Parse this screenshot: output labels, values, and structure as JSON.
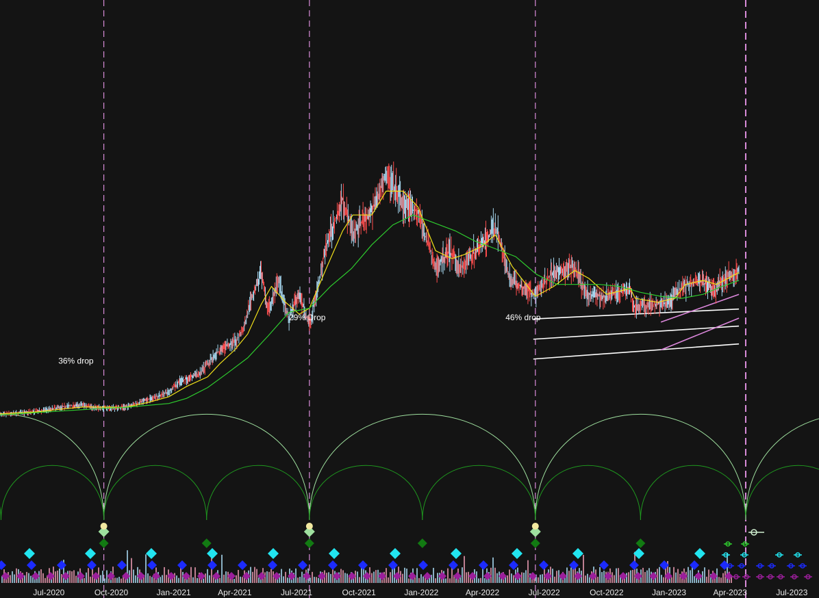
{
  "chart_data": {
    "type": "line",
    "title": "",
    "xlabel": "",
    "ylabel": "",
    "x_ticks": [
      "Jul-2020",
      "Oct-2020",
      "Jan-2021",
      "Apr-2021",
      "Jul-2021",
      "Oct-2021",
      "Jan-2022",
      "Apr-2022",
      "Jul-2022",
      "Oct-2022",
      "Jan-2023",
      "Apr-2023",
      "Jul-2023"
    ],
    "xlim": [
      "2020-04-20",
      "2023-08-10"
    ],
    "ylim": [
      0,
      100
    ],
    "y_axis_visible": false,
    "grid": false,
    "series": [
      {
        "color": "#ff6b6b",
        "x": [
          "2020-04-20",
          "2020-06-15",
          "2020-07-20",
          "2020-08-20",
          "2020-09-05",
          "2020-09-20",
          "2020-10-20",
          "2020-11-25",
          "2020-12-25",
          "2021-01-10",
          "2021-02-10",
          "2021-03-01",
          "2021-03-15",
          "2021-04-01",
          "2021-04-14",
          "2021-04-25",
          "2021-05-10",
          "2021-05-20",
          "2021-06-05",
          "2021-06-20",
          "2021-07-05",
          "2021-07-20",
          "2021-08-15",
          "2021-09-07",
          "2021-09-22",
          "2021-10-20",
          "2021-11-10",
          "2021-12-05",
          "2021-12-27",
          "2022-01-22",
          "2022-02-10",
          "2022-03-01",
          "2022-03-28",
          "2022-04-20",
          "2022-05-12",
          "2022-06-18",
          "2022-07-10",
          "2022-08-13",
          "2022-09-01",
          "2022-10-01",
          "2022-11-05",
          "2022-11-09",
          "2022-12-15",
          "2023-01-01",
          "2023-01-20",
          "2023-02-15",
          "2023-03-10",
          "2023-03-25",
          "2023-04-14"
        ],
        "values": [
          0.7,
          1.5,
          2.7,
          3.2,
          2.5,
          2.3,
          2.5,
          4.5,
          6.5,
          9.0,
          11.2,
          15.5,
          17.5,
          19.0,
          22.0,
          30.0,
          36.0,
          27.0,
          34.0,
          25.0,
          31.0,
          23.0,
          44.0,
          55.0,
          46.5,
          52.0,
          61.0,
          54.0,
          51.5,
          37.5,
          42.0,
          38.0,
          43.0,
          48.0,
          35.0,
          30.7,
          36.0,
          38.0,
          31.0,
          30.5,
          32.5,
          28.0,
          28.5,
          29.0,
          33.0,
          34.5,
          32.0,
          35.0,
          37.0
        ]
      },
      {
        "color": "#f2e11a",
        "x": [
          "2020-04-20",
          "2020-06-15",
          "2020-07-20",
          "2020-08-20",
          "2020-09-20",
          "2020-10-20",
          "2020-11-25",
          "2020-12-25",
          "2021-01-20",
          "2021-02-20",
          "2021-03-10",
          "2021-04-01",
          "2021-04-20",
          "2021-05-10",
          "2021-05-25",
          "2021-06-15",
          "2021-07-05",
          "2021-07-20",
          "2021-08-15",
          "2021-09-07",
          "2021-09-22",
          "2021-10-20",
          "2021-11-10",
          "2021-12-05",
          "2021-12-27",
          "2022-01-22",
          "2022-02-15",
          "2022-03-05",
          "2022-03-30",
          "2022-04-20",
          "2022-05-15",
          "2022-06-18",
          "2022-07-15",
          "2022-08-15",
          "2022-09-05",
          "2022-10-01",
          "2022-11-05",
          "2022-11-12",
          "2022-12-15",
          "2023-01-10",
          "2023-01-25",
          "2023-02-20",
          "2023-03-12",
          "2023-04-14"
        ],
        "values": [
          0.9,
          1.4,
          2.1,
          2.6,
          2.6,
          2.5,
          3.8,
          5.2,
          7.8,
          10.2,
          13.5,
          17.0,
          21.0,
          28.5,
          33.0,
          29.0,
          26.0,
          27.5,
          38.0,
          47.0,
          51.0,
          51.0,
          57.0,
          57.0,
          53.0,
          42.0,
          40.0,
          41.0,
          43.0,
          46.0,
          38.0,
          30.5,
          33.0,
          37.0,
          35.0,
          31.0,
          32.5,
          30.0,
          29.0,
          30.0,
          33.5,
          34.5,
          33.5,
          36.5
        ]
      },
      {
        "color": "#2ecc2e",
        "x": [
          "2020-04-20",
          "2020-07-20",
          "2020-09-20",
          "2020-10-20",
          "2020-12-25",
          "2021-01-20",
          "2021-02-20",
          "2021-03-20",
          "2021-04-20",
          "2021-05-20",
          "2021-06-20",
          "2021-07-20",
          "2021-08-20",
          "2021-09-20",
          "2021-10-20",
          "2021-11-20",
          "2021-12-20",
          "2022-01-20",
          "2022-02-20",
          "2022-03-20",
          "2022-04-20",
          "2022-05-20",
          "2022-06-20",
          "2022-07-20",
          "2022-08-20",
          "2022-09-20",
          "2022-10-20",
          "2022-11-20",
          "2022-12-20",
          "2023-01-20",
          "2023-02-20",
          "2023-03-20",
          "2023-04-14"
        ],
        "values": [
          0.6,
          1.6,
          2.3,
          2.5,
          3.5,
          4.8,
          7.5,
          11.0,
          15.0,
          20.5,
          26.5,
          27.5,
          33.0,
          37.5,
          43.5,
          48.5,
          51.0,
          49.0,
          47.0,
          44.5,
          42.5,
          40.5,
          36.0,
          33.5,
          33.5,
          33.5,
          33.0,
          31.5,
          30.5,
          30.0,
          31.0,
          33.0,
          34.5
        ]
      }
    ],
    "annotations": [
      {
        "text": "36% drop",
        "x": "2020-07-15",
        "y": 13.5
      },
      {
        "text": "29% Drop",
        "x": "2021-06-20",
        "y": 24.5
      },
      {
        "text": "46% drop",
        "x": "2022-05-05",
        "y": 24.5
      }
    ],
    "cycle_lines": [
      "2020-09-20",
      "2021-07-20",
      "2022-06-18",
      "2023-04-24"
    ],
    "trend_channel": {
      "x_range": [
        "2022-06-15",
        "2023-04-14"
      ],
      "upper": [
        24.8,
        27.3
      ],
      "middle": [
        19.7,
        23.0
      ],
      "lower": [
        14.7,
        18.5
      ]
    },
    "rising_wedge": {
      "x_range": [
        "2022-12-20",
        "2023-04-14"
      ],
      "upper": [
        24.0,
        31.0
      ],
      "lower": [
        17.0,
        25.0
      ]
    }
  }
}
